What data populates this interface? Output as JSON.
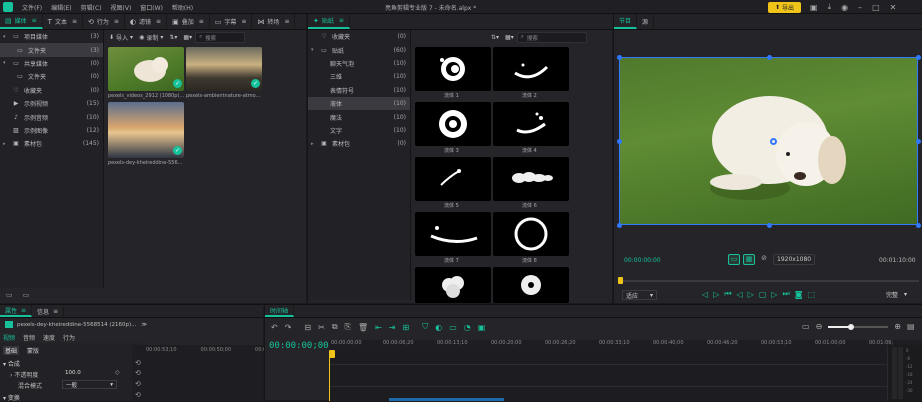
{
  "titlebar": {
    "menus": [
      "文件(F)",
      "编辑(E)",
      "剪辑(C)",
      "视图(V)",
      "窗口(W)",
      "帮助(H)"
    ],
    "title": "亮鱼剪辑专业版 7 - 未命名.alpx *",
    "export_label": "导出"
  },
  "library_tabs": [
    {
      "label": "媒体",
      "icon": "media-icon"
    },
    {
      "label": "文本",
      "icon": "text-icon"
    },
    {
      "label": "行为",
      "icon": "behavior-icon"
    },
    {
      "label": "滤镜",
      "icon": "filter-icon"
    },
    {
      "label": "叠加",
      "icon": "overlay-icon"
    },
    {
      "label": "字幕",
      "icon": "subtitle-icon"
    },
    {
      "label": "转场",
      "icon": "transition-icon"
    },
    {
      "label": "贴纸",
      "icon": "sticker-icon"
    }
  ],
  "media_tree": [
    {
      "label": "项目媒体",
      "count": "(3)",
      "depth": 0
    },
    {
      "label": "文件夹",
      "count": "(3)",
      "depth": 1,
      "selected": true
    },
    {
      "label": "共享媒体",
      "count": "(0)",
      "depth": 0
    },
    {
      "label": "文件夹",
      "count": "(0)",
      "depth": 1
    },
    {
      "label": "收藏夹",
      "count": "(0)",
      "depth": 0
    },
    {
      "label": "示例视频",
      "count": "(15)",
      "depth": 0
    },
    {
      "label": "示例音频",
      "count": "(10)",
      "depth": 0
    },
    {
      "label": "示例图像",
      "count": "(12)",
      "depth": 0
    },
    {
      "label": "素材包",
      "count": "(145)",
      "depth": 0
    }
  ],
  "media_toolbar": {
    "import": "导入",
    "record": "录制",
    "search_placeholder": "搜索"
  },
  "media_items": [
    {
      "label": "pexels_videos_2912 (1080p)..."
    },
    {
      "label": "pexels-ambientnature-atmo..."
    },
    {
      "label": "pexels-dey-kheireddine-556..."
    }
  ],
  "sticker_tree": [
    {
      "label": "收藏夹",
      "count": "(0)",
      "depth": 0
    },
    {
      "label": "贴纸",
      "count": "(60)",
      "depth": 0
    },
    {
      "label": "聊天气泡",
      "count": "(10)",
      "depth": 1
    },
    {
      "label": "三维",
      "count": "(10)",
      "depth": 1
    },
    {
      "label": "表情符号",
      "count": "(10)",
      "depth": 1
    },
    {
      "label": "液体",
      "count": "(10)",
      "depth": 1,
      "selected": true
    },
    {
      "label": "魔法",
      "count": "(10)",
      "depth": 1
    },
    {
      "label": "文字",
      "count": "(10)",
      "depth": 1
    },
    {
      "label": "素材包",
      "count": "(0)",
      "depth": 0
    }
  ],
  "sticker_search_placeholder": "搜索",
  "stickers": [
    "流体 1",
    "流体 2",
    "流体 3",
    "流体 4",
    "流体 5",
    "流体 6",
    "流体 7",
    "流体 8",
    "",
    ""
  ],
  "preview": {
    "tabs": [
      "节目",
      "源"
    ],
    "time_current": "00:00:00:00",
    "time_total": "00:01:10:00",
    "resolution": "1920x1080",
    "fit_label": "适应",
    "quality_label": "完整"
  },
  "props": {
    "tabs": [
      "属性",
      "信息"
    ],
    "clip_name": "pexels-dey-kheireddine-5568514 (2160p)...",
    "subtabs": [
      "视频",
      "音频",
      "速度",
      "行为"
    ],
    "section_tabs": [
      "基础",
      "蒙版"
    ],
    "group_label": "合成",
    "opacity_label": "不透明度",
    "opacity_value": "100.0",
    "blend_label": "混合模式",
    "blend_value": "一般",
    "transform_label": "变换",
    "ruler": [
      "00:00:53;10",
      "00:00:50;00",
      "00:00:56;00"
    ]
  },
  "timeline": {
    "tab": "时间轴",
    "timecode": "00:00:00;00",
    "ruler": [
      "00:00:00;00",
      "00:00:06;20",
      "00:00:13;10",
      "00:00:20;00",
      "00:00:26;20",
      "00:00:33;10",
      "00:00:40;00",
      "00:00:46;20",
      "00:00:53;10",
      "00:01:00;00",
      "00:01:06;"
    ]
  },
  "colors": {
    "accent": "#16c29b",
    "export": "#f0c419",
    "selection_handle": "#2f78ff"
  }
}
